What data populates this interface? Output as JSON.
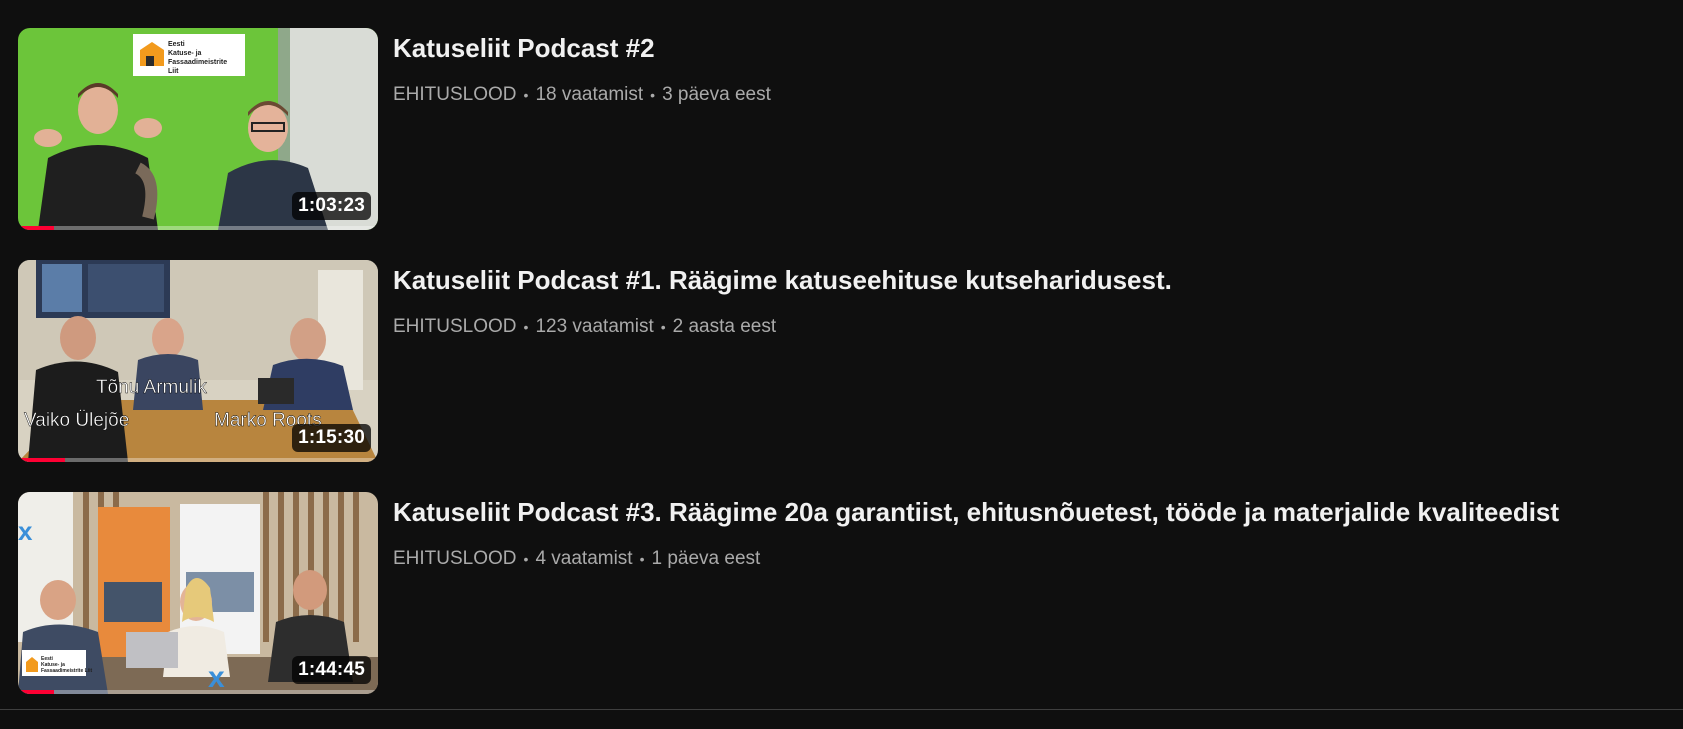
{
  "videos": [
    {
      "title": "Katuseliit Podcast #2",
      "channel": "EHITUSLOOD",
      "views": "18 vaatamist",
      "age": "3 päeva eest",
      "duration": "1:03:23",
      "watched_fraction": 0.1,
      "thumb_logo": "Eesti Katuse- ja Fassaadimeistrite Liit"
    },
    {
      "title": "Katuseliit Podcast #1. Räägime katuseehituse kutseharidusest.",
      "channel": "EHITUSLOOD",
      "views": "123 vaatamist",
      "age": "2 aasta eest",
      "duration": "1:15:30",
      "watched_fraction": 0.13,
      "thumb_names": [
        "Tõnu Armulik",
        "Vaiko Ülejõe",
        "Marko Roots"
      ]
    },
    {
      "title": "Katuseliit Podcast #3. Räägime 20a garantiist, ehitusnõuetest, tööde ja materjalide kvaliteedist",
      "channel": "EHITUSLOOD",
      "views": "4 vaatamist",
      "age": "1 päeva eest",
      "duration": "1:44:45",
      "watched_fraction": 0.1,
      "thumb_logo": "Eesti Katuse- ja Fassaadimeistrite Liit"
    }
  ],
  "separator": "•",
  "colors": {
    "background": "#0f0f0f",
    "title": "#f1f1f1",
    "meta": "#aaaaaa",
    "progress": "#ff0033"
  }
}
